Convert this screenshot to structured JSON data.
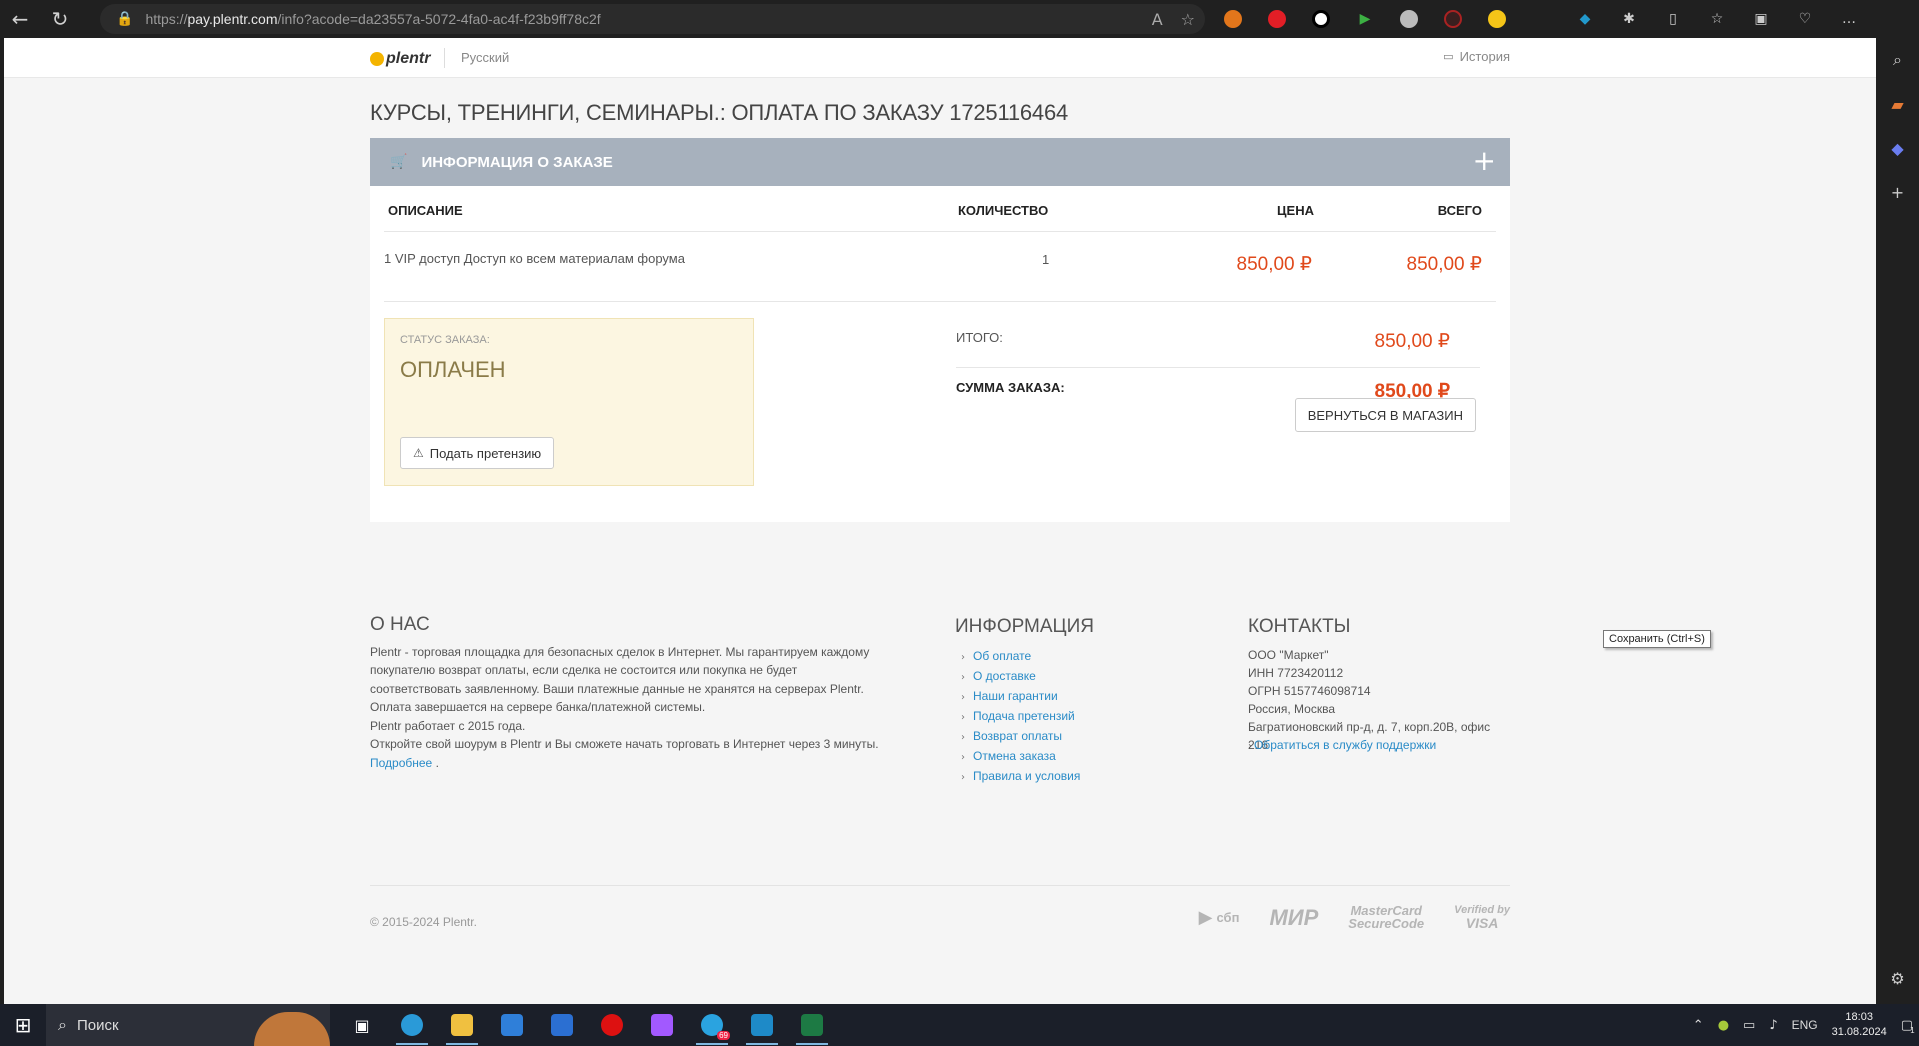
{
  "browser": {
    "url_prefix": "https://",
    "url_host": "pay.plentr.com",
    "url_path": "/info?acode=da23557a-5072-4fa0-ac4f-f23b9ff78c2f",
    "tooltip": "Сохранить (Ctrl+S)"
  },
  "site": {
    "logo": "plentr",
    "language": "Русский",
    "history": "История"
  },
  "page": {
    "title": "КУРСЫ, ТРЕНИНГИ, СЕМИНАРЫ.: ОПЛАТА ПО ЗАКАЗУ 1725116464"
  },
  "order": {
    "header": "ИНФОРМАЦИЯ О ЗАКАЗЕ",
    "columns": {
      "description": "ОПИСАНИЕ",
      "quantity": "КОЛИЧЕСТВО",
      "price": "ЦЕНА",
      "total": "ВСЕГО"
    },
    "items": [
      {
        "description": "1 VIP доступ Доступ ко всем материалам форума",
        "quantity": "1",
        "price": "850,00 ₽",
        "total": "850,00 ₽"
      }
    ],
    "status_label": "СТАТУС ЗАКАЗА:",
    "status_value": "ОПЛАЧЕН",
    "claim_button": "Подать претензию",
    "subtotal_label": "ИТОГО:",
    "subtotal_value": "850,00 ₽",
    "sum_label": "СУММА ЗАКАЗА:",
    "sum_value": "850,00 ₽",
    "back_button": "ВЕРНУТЬСЯ В МАГАЗИН"
  },
  "footer": {
    "about_title": "О НАС",
    "about_text_1": "Plentr - торговая площадка для безопасных сделок в Интернет. Мы гарантируем каждому покупателю возврат оплаты, если сделка не состоится или покупка не будет соответствовать заявленному. Ваши платежные данные не хранятся на серверах Plentr. Оплата завершается на сервере банка/платежной системы.",
    "about_text_2": "Plentr работает с 2015 года.",
    "about_text_3": "Откройте свой шоурум в Plentr и Вы сможете начать торговать в Интернет через 3 минуты.",
    "about_more": "Подробнее",
    "info_title": "ИНФОРМАЦИЯ",
    "info_links": [
      "Об оплате",
      "О доставке",
      "Наши гарантии",
      "Подача претензий",
      "Возврат оплаты",
      "Отмена заказа",
      "Правила и условия"
    ],
    "contacts_title": "КОНТАКТЫ",
    "contacts": [
      "ООО \"Маркет\"",
      "ИНН 7723420112",
      "ОГРН 5157746098714",
      "Россия, Москва",
      "Багратионовский пр-д, д. 7, корп.20В, офис 216"
    ],
    "support_link": "Обратиться в службу поддержки",
    "copyright": "© 2015-2024 Plentr.",
    "payment_logos": {
      "sbp": "сбп",
      "mir": "МИР",
      "mastercard_1": "MasterCard",
      "mastercard_2": "SecureCode",
      "visa_1": "Verified by",
      "visa_2": "VISA"
    }
  },
  "taskbar": {
    "search_placeholder": "Поиск",
    "language": "ENG",
    "time": "18:03",
    "date": "31.08.2024",
    "telegram_badge": "69",
    "notification_count": "1"
  }
}
